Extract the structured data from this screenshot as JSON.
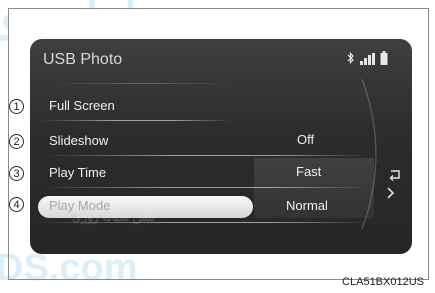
{
  "screen": {
    "title": "USB Photo",
    "status_icons": [
      "bluetooth-icon",
      "signal-icon",
      "battery-icon"
    ]
  },
  "menu": {
    "items": [
      {
        "label": "Full Screen",
        "value": ""
      },
      {
        "label": "Slideshow",
        "value": "Off"
      },
      {
        "label": "Play Time",
        "value": "Fast"
      },
      {
        "label": "Play Mode",
        "value": "Normal"
      }
    ],
    "selected_index": 3
  },
  "controls": {
    "return_icon": "return-icon",
    "next_icon": "chevron-right-icon"
  },
  "callouts": [
    "1",
    "2",
    "3",
    "4"
  ],
  "figure_code": "CLA51BX012US",
  "watermark": {
    "top": "اماد جو",
    "middle": "تلفن شبانه روزی",
    "bottom": "DS.com"
  },
  "colors": {
    "screen_bg": "#2c2c2c",
    "text": "#f0f0f0",
    "highlight": "#f2f2f2",
    "watermark": "#3ca0d2"
  }
}
